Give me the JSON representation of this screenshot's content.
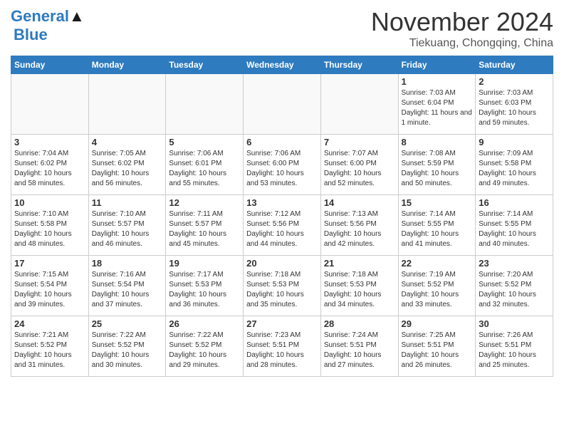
{
  "header": {
    "logo_line1": "General",
    "logo_line2": "Blue",
    "month": "November 2024",
    "location": "Tiekuang, Chongqing, China"
  },
  "days_of_week": [
    "Sunday",
    "Monday",
    "Tuesday",
    "Wednesday",
    "Thursday",
    "Friday",
    "Saturday"
  ],
  "weeks": [
    [
      {
        "day": "",
        "info": ""
      },
      {
        "day": "",
        "info": ""
      },
      {
        "day": "",
        "info": ""
      },
      {
        "day": "",
        "info": ""
      },
      {
        "day": "",
        "info": ""
      },
      {
        "day": "1",
        "info": "Sunrise: 7:03 AM\nSunset: 6:04 PM\nDaylight: 11 hours and 1 minute."
      },
      {
        "day": "2",
        "info": "Sunrise: 7:03 AM\nSunset: 6:03 PM\nDaylight: 10 hours and 59 minutes."
      }
    ],
    [
      {
        "day": "3",
        "info": "Sunrise: 7:04 AM\nSunset: 6:02 PM\nDaylight: 10 hours and 58 minutes."
      },
      {
        "day": "4",
        "info": "Sunrise: 7:05 AM\nSunset: 6:02 PM\nDaylight: 10 hours and 56 minutes."
      },
      {
        "day": "5",
        "info": "Sunrise: 7:06 AM\nSunset: 6:01 PM\nDaylight: 10 hours and 55 minutes."
      },
      {
        "day": "6",
        "info": "Sunrise: 7:06 AM\nSunset: 6:00 PM\nDaylight: 10 hours and 53 minutes."
      },
      {
        "day": "7",
        "info": "Sunrise: 7:07 AM\nSunset: 6:00 PM\nDaylight: 10 hours and 52 minutes."
      },
      {
        "day": "8",
        "info": "Sunrise: 7:08 AM\nSunset: 5:59 PM\nDaylight: 10 hours and 50 minutes."
      },
      {
        "day": "9",
        "info": "Sunrise: 7:09 AM\nSunset: 5:58 PM\nDaylight: 10 hours and 49 minutes."
      }
    ],
    [
      {
        "day": "10",
        "info": "Sunrise: 7:10 AM\nSunset: 5:58 PM\nDaylight: 10 hours and 48 minutes."
      },
      {
        "day": "11",
        "info": "Sunrise: 7:10 AM\nSunset: 5:57 PM\nDaylight: 10 hours and 46 minutes."
      },
      {
        "day": "12",
        "info": "Sunrise: 7:11 AM\nSunset: 5:57 PM\nDaylight: 10 hours and 45 minutes."
      },
      {
        "day": "13",
        "info": "Sunrise: 7:12 AM\nSunset: 5:56 PM\nDaylight: 10 hours and 44 minutes."
      },
      {
        "day": "14",
        "info": "Sunrise: 7:13 AM\nSunset: 5:56 PM\nDaylight: 10 hours and 42 minutes."
      },
      {
        "day": "15",
        "info": "Sunrise: 7:14 AM\nSunset: 5:55 PM\nDaylight: 10 hours and 41 minutes."
      },
      {
        "day": "16",
        "info": "Sunrise: 7:14 AM\nSunset: 5:55 PM\nDaylight: 10 hours and 40 minutes."
      }
    ],
    [
      {
        "day": "17",
        "info": "Sunrise: 7:15 AM\nSunset: 5:54 PM\nDaylight: 10 hours and 39 minutes."
      },
      {
        "day": "18",
        "info": "Sunrise: 7:16 AM\nSunset: 5:54 PM\nDaylight: 10 hours and 37 minutes."
      },
      {
        "day": "19",
        "info": "Sunrise: 7:17 AM\nSunset: 5:53 PM\nDaylight: 10 hours and 36 minutes."
      },
      {
        "day": "20",
        "info": "Sunrise: 7:18 AM\nSunset: 5:53 PM\nDaylight: 10 hours and 35 minutes."
      },
      {
        "day": "21",
        "info": "Sunrise: 7:18 AM\nSunset: 5:53 PM\nDaylight: 10 hours and 34 minutes."
      },
      {
        "day": "22",
        "info": "Sunrise: 7:19 AM\nSunset: 5:52 PM\nDaylight: 10 hours and 33 minutes."
      },
      {
        "day": "23",
        "info": "Sunrise: 7:20 AM\nSunset: 5:52 PM\nDaylight: 10 hours and 32 minutes."
      }
    ],
    [
      {
        "day": "24",
        "info": "Sunrise: 7:21 AM\nSunset: 5:52 PM\nDaylight: 10 hours and 31 minutes."
      },
      {
        "day": "25",
        "info": "Sunrise: 7:22 AM\nSunset: 5:52 PM\nDaylight: 10 hours and 30 minutes."
      },
      {
        "day": "26",
        "info": "Sunrise: 7:22 AM\nSunset: 5:52 PM\nDaylight: 10 hours and 29 minutes."
      },
      {
        "day": "27",
        "info": "Sunrise: 7:23 AM\nSunset: 5:51 PM\nDaylight: 10 hours and 28 minutes."
      },
      {
        "day": "28",
        "info": "Sunrise: 7:24 AM\nSunset: 5:51 PM\nDaylight: 10 hours and 27 minutes."
      },
      {
        "day": "29",
        "info": "Sunrise: 7:25 AM\nSunset: 5:51 PM\nDaylight: 10 hours and 26 minutes."
      },
      {
        "day": "30",
        "info": "Sunrise: 7:26 AM\nSunset: 5:51 PM\nDaylight: 10 hours and 25 minutes."
      }
    ]
  ]
}
